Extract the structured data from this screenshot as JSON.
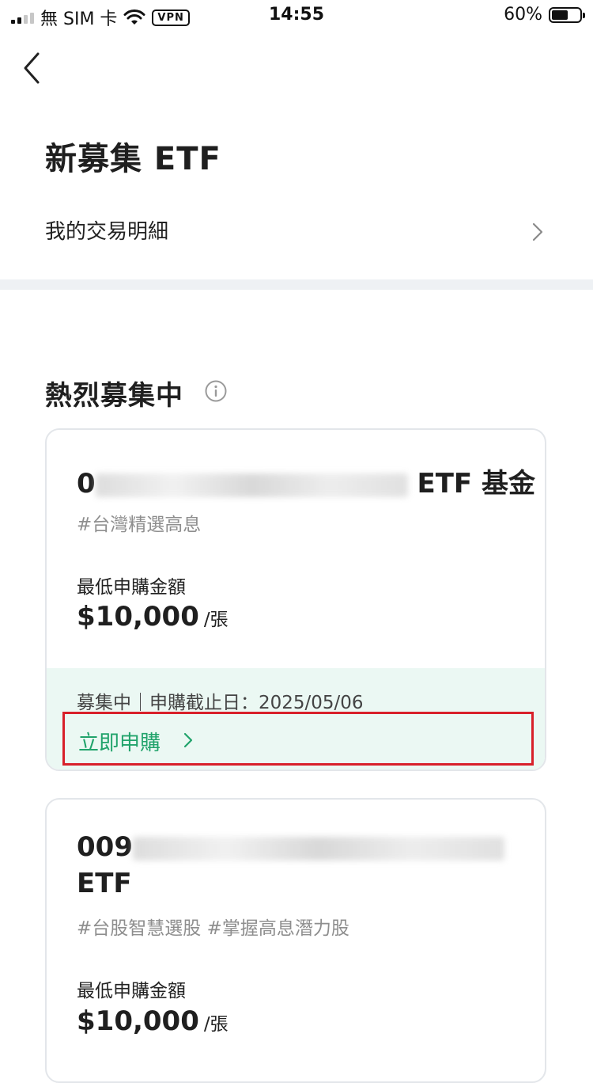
{
  "status_bar": {
    "carrier": "無 SIM 卡",
    "vpn": "VPN",
    "time": "14:55",
    "battery": "60%",
    "battery_level": 0.6
  },
  "header": {
    "title": "新募集 ETF",
    "transactions_label": "我的交易明細"
  },
  "section": {
    "title": "熱烈募集中"
  },
  "funds": [
    {
      "name_prefix": "0",
      "name_suffix": "ETF 基金",
      "tags": "#台灣精選高息",
      "min_label": "最低申購金額",
      "amount": "$10,000",
      "unit": "/張",
      "deadline": "募集中｜申購截止日：2025/05/06",
      "subscribe_label": "立即申購"
    },
    {
      "name_prefix": "009",
      "name_line2": "ETF",
      "tags": "#台股智慧選股 #掌握高息潛力股",
      "min_label": "最低申購金額",
      "amount": "$10,000",
      "unit": "/張"
    }
  ],
  "colors": {
    "accent_green": "#21a36b",
    "highlight_box": "#d8202a",
    "footer_bg": "#ebf8f3"
  }
}
